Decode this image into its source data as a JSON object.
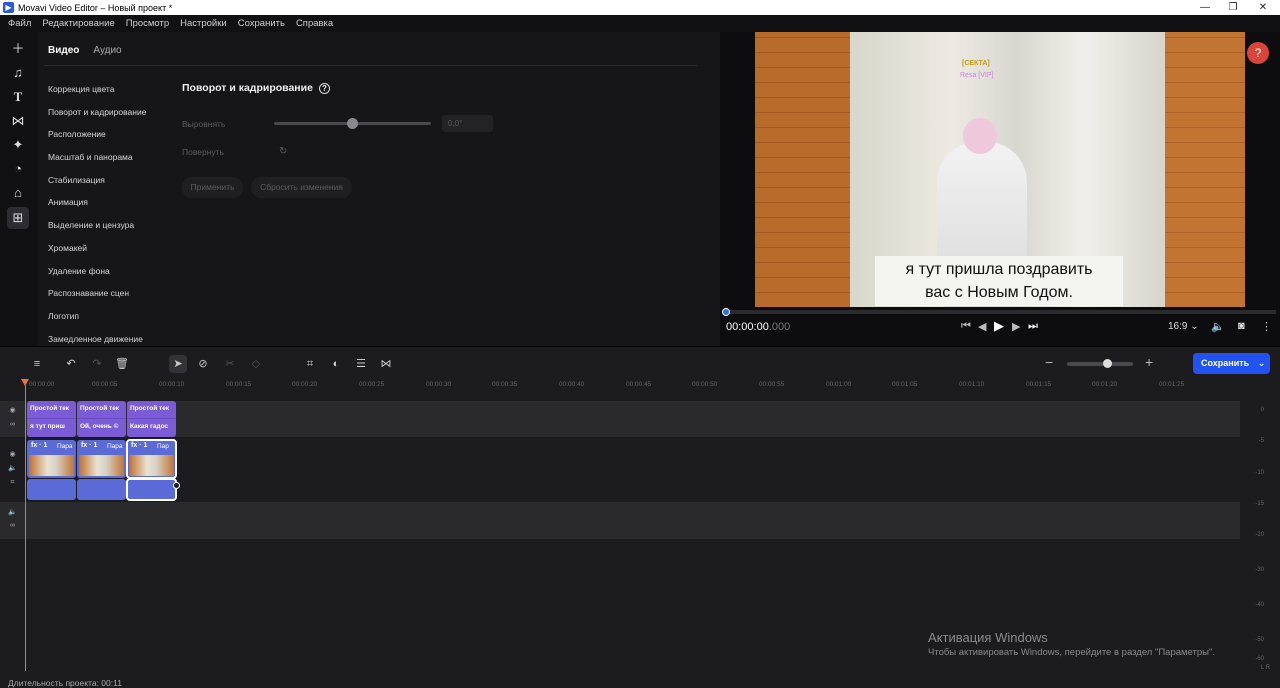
{
  "window": {
    "title": "Movavi Video Editor – Новый проект *",
    "min": "—",
    "max": "❐",
    "close": "✕"
  },
  "menu": [
    "Файл",
    "Редактирование",
    "Просмотр",
    "Настройки",
    "Сохранить",
    "Справка"
  ],
  "leftbar": {
    "items": [
      "add-media-icon",
      "music-icon",
      "text-icon",
      "transitions-icon",
      "filters-icon",
      "stickers-icon",
      "clip-tools-icon",
      "more-tools-icon"
    ]
  },
  "panel": {
    "tabs": [
      "Видео",
      "Аудио"
    ],
    "tools": [
      "Коррекция цвета",
      "Поворот и кадрирование",
      "Расположение",
      "Масштаб и панорама",
      "Стабилизация",
      "Анимация",
      "Выделение и цензура",
      "Хромакей",
      "Удаление фона",
      "Распознавание сцен",
      "Логотип",
      "Замедленное движение"
    ],
    "section_title": "Поворот и кадрирование",
    "align_label": "Выровнять",
    "align_value": "0,0°",
    "align_level": 0.5,
    "rotate_label": "Повернуть",
    "apply_label": "Применить",
    "reset_label": "Сбросить изменения"
  },
  "preview": {
    "nick1": "[СЕКТА]",
    "nick2": "Resa [VIP]",
    "subtitle_line1": "я тут пришла поздравить",
    "subtitle_line2": "вас с Новым Годом.",
    "timecode": "00:00:00",
    "timecode_ms": ".000",
    "aspect": "16:9",
    "help": "?"
  },
  "timeline": {
    "save_label": "Сохранить",
    "ruler": [
      "00:00:00",
      "00:00:05",
      "00:00:10",
      "00:00:15",
      "00:00:20",
      "00:00:25",
      "00:00:30",
      "00:00:35",
      "00:00:40",
      "00:00:45",
      "00:00:50",
      "00:00:55",
      "00:01:00",
      "00:01:05",
      "00:01:10",
      "00:01:15",
      "00:01:20",
      "00:01:25"
    ],
    "text_clips": [
      {
        "title": "Простой тек",
        "text": "я тут приш"
      },
      {
        "title": "Простой тек",
        "text": "Ой, очень ©"
      },
      {
        "title": "Простой тек",
        "text": "Какая гадос"
      }
    ],
    "video_clips": [
      {
        "fx": "fx · 1",
        "par": "Пара"
      },
      {
        "fx": "fx · 1",
        "par": "Пара"
      },
      {
        "fx": "fx · 1",
        "par": "Пар"
      }
    ],
    "meter": [
      "0",
      "-5",
      "-10",
      "-15",
      "-20",
      "-30",
      "-40",
      "-50",
      "-60"
    ],
    "meter_lr": "L R"
  },
  "activation": {
    "title": "Активация Windows",
    "text": "Чтобы активировать Windows, перейдите в раздел \"Параметры\"."
  },
  "status": {
    "duration": "Длительность проекта: 00:11"
  }
}
